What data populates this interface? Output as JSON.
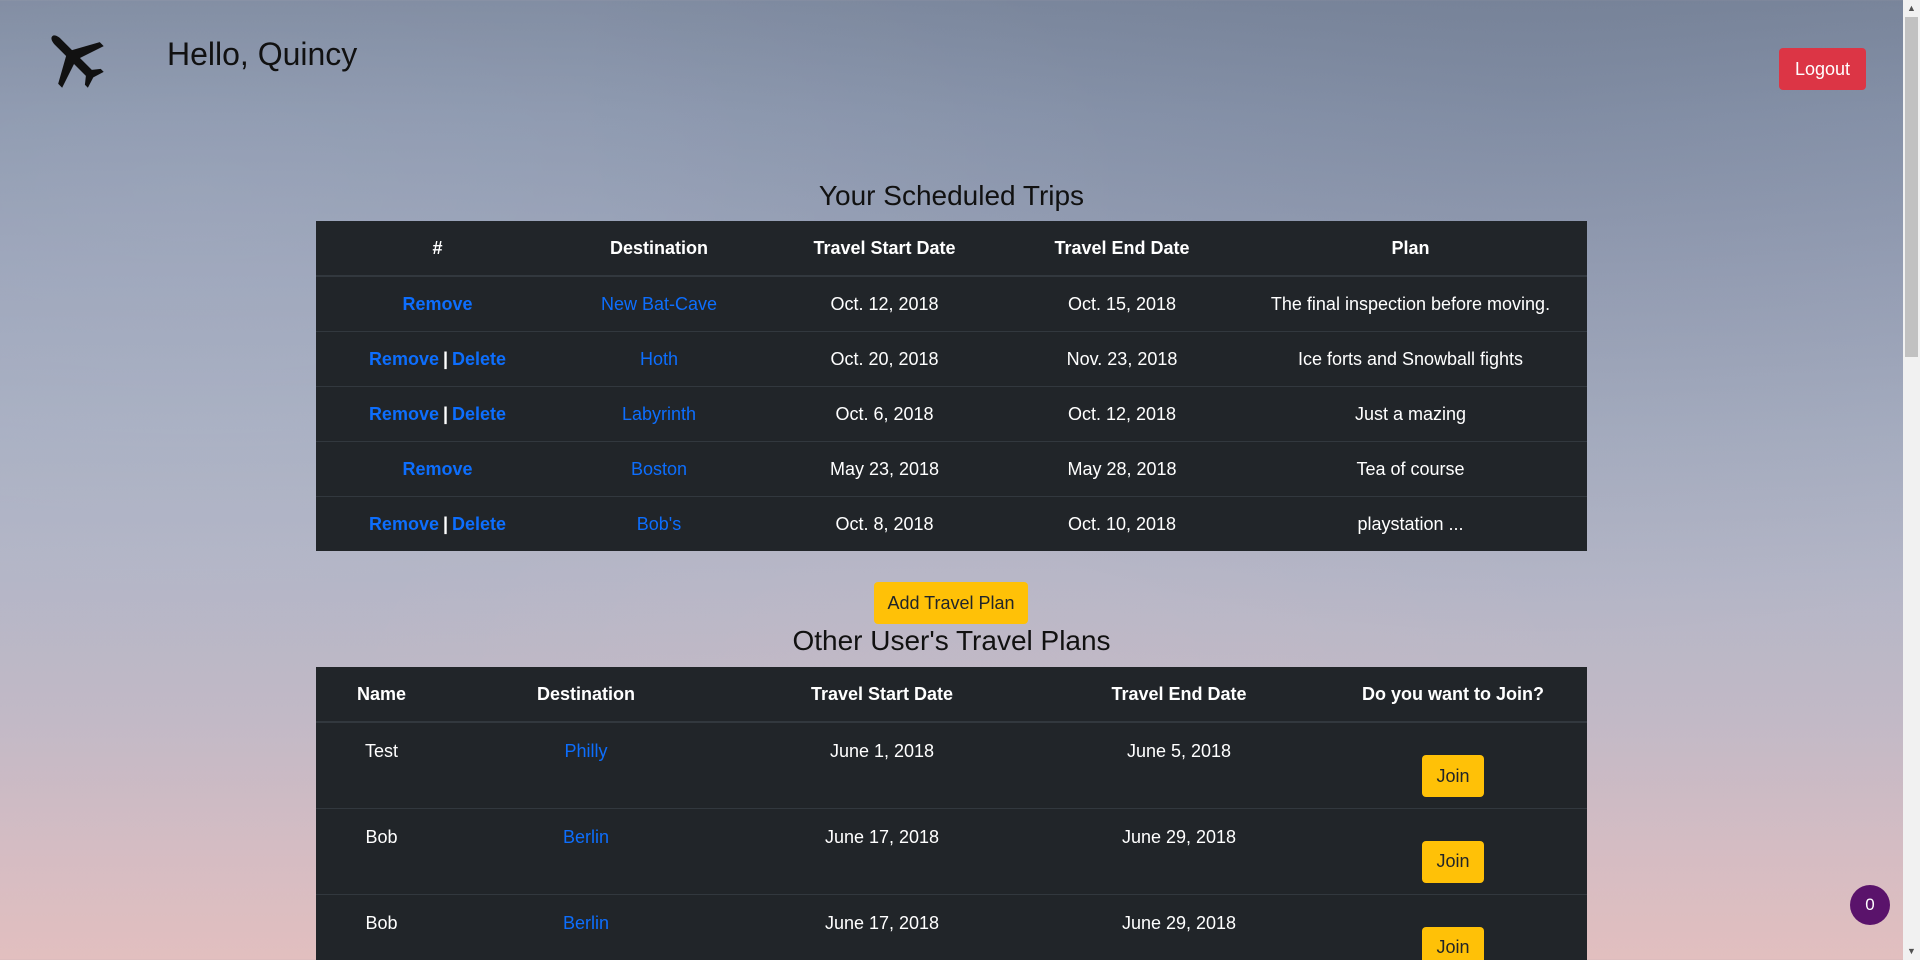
{
  "header": {
    "greeting": "Hello, Quincy",
    "logout_label": "Logout",
    "logo_icon": "airplane-icon"
  },
  "trips": {
    "title": "Your Scheduled Trips",
    "columns": [
      "#",
      "Destination",
      "Travel Start Date",
      "Travel End Date",
      "Plan"
    ],
    "rows": [
      {
        "remove": "Remove",
        "delete": "",
        "destination": "New Bat-Cave",
        "start": "Oct. 12, 2018",
        "end": "Oct. 15, 2018",
        "plan": "The final inspection before moving."
      },
      {
        "remove": "Remove",
        "delete": "Delete",
        "destination": "Hoth",
        "start": "Oct. 20, 2018",
        "end": "Nov. 23, 2018",
        "plan": "Ice forts and Snowball fights"
      },
      {
        "remove": "Remove",
        "delete": "Delete",
        "destination": "Labyrinth",
        "start": "Oct. 6, 2018",
        "end": "Oct. 12, 2018",
        "plan": "Just a mazing"
      },
      {
        "remove": "Remove",
        "delete": "",
        "destination": "Boston",
        "start": "May 23, 2018",
        "end": "May 28, 2018",
        "plan": "Tea of course"
      },
      {
        "remove": "Remove",
        "delete": "Delete",
        "destination": "Bob's",
        "start": "Oct. 8, 2018",
        "end": "Oct. 10, 2018",
        "plan": "playstation ..."
      }
    ],
    "separator": "|"
  },
  "add_plan_label": "Add Travel Plan",
  "others": {
    "title": "Other User's Travel Plans",
    "columns": [
      "Name",
      "Destination",
      "Travel Start Date",
      "Travel End Date",
      "Do you want to Join?"
    ],
    "rows": [
      {
        "name": "Test",
        "destination": "Philly",
        "start": "June 1, 2018",
        "end": "June 5, 2018",
        "join": "Join"
      },
      {
        "name": "Bob",
        "destination": "Berlin",
        "start": "June 17, 2018",
        "end": "June 29, 2018",
        "join": "Join"
      },
      {
        "name": "Bob",
        "destination": "Berlin",
        "start": "June 17, 2018",
        "end": "June 29, 2018",
        "join": "Join"
      }
    ]
  },
  "badge_count": "0",
  "colors": {
    "table_bg": "#212529",
    "link": "#0d6efd",
    "warning": "#ffc107",
    "danger": "#dc3545",
    "badge": "#5a136b"
  }
}
